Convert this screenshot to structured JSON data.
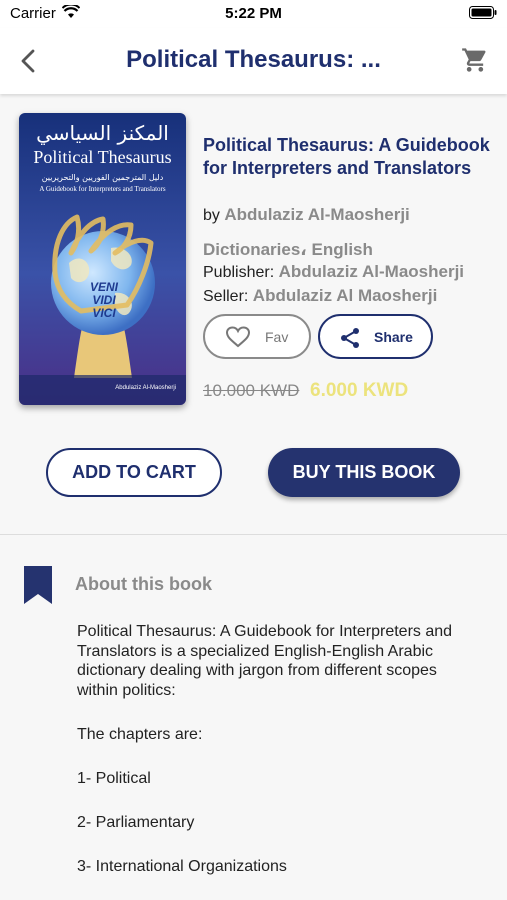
{
  "status_bar": {
    "carrier": "Carrier",
    "time": "5:22 PM"
  },
  "nav": {
    "title": "Political Thesaurus: ..."
  },
  "cover": {
    "title_ar": "المكنز السياسي",
    "title_en": "Political Thesaurus",
    "subtitle_ar": "دليل المترجمين الفوريين والتحريريين",
    "subtitle_en": "A Guidebook for Interpreters and Translators",
    "motto": [
      "VENI",
      "VIDI",
      "VICI"
    ],
    "author": "Abdulaziz Al-Maosherji"
  },
  "book": {
    "title": "Political Thesaurus: A Guidebook for Interpreters and Translators",
    "by_label": "by ",
    "author": "Abdulaziz Al-Maosherji",
    "category": "Dictionaries، English",
    "publisher_label": "Publisher: ",
    "publisher": "Abdulaziz Al-Maosherji",
    "seller_label": "Seller: ",
    "seller": "Abdulaziz Al Maosherji",
    "price_old": "10.000 KWD",
    "price_new": "6.000 KWD"
  },
  "actions": {
    "fav": "Fav",
    "share": "Share",
    "add_to_cart": "ADD TO CART",
    "buy": "BUY THIS BOOK"
  },
  "about": {
    "heading": "About this book",
    "paragraphs": [
      "Political Thesaurus: A Guidebook for Interpreters and Translators is a specialized English-English Arabic dictionary dealing with jargon from different scopes within politics:",
      "The chapters are:",
      "1- Political",
      "2- Parliamentary",
      "3- International Organizations"
    ]
  },
  "colors": {
    "primary": "#1f2f6e",
    "price_new": "#ece37d",
    "muted": "#8a8a8a"
  }
}
